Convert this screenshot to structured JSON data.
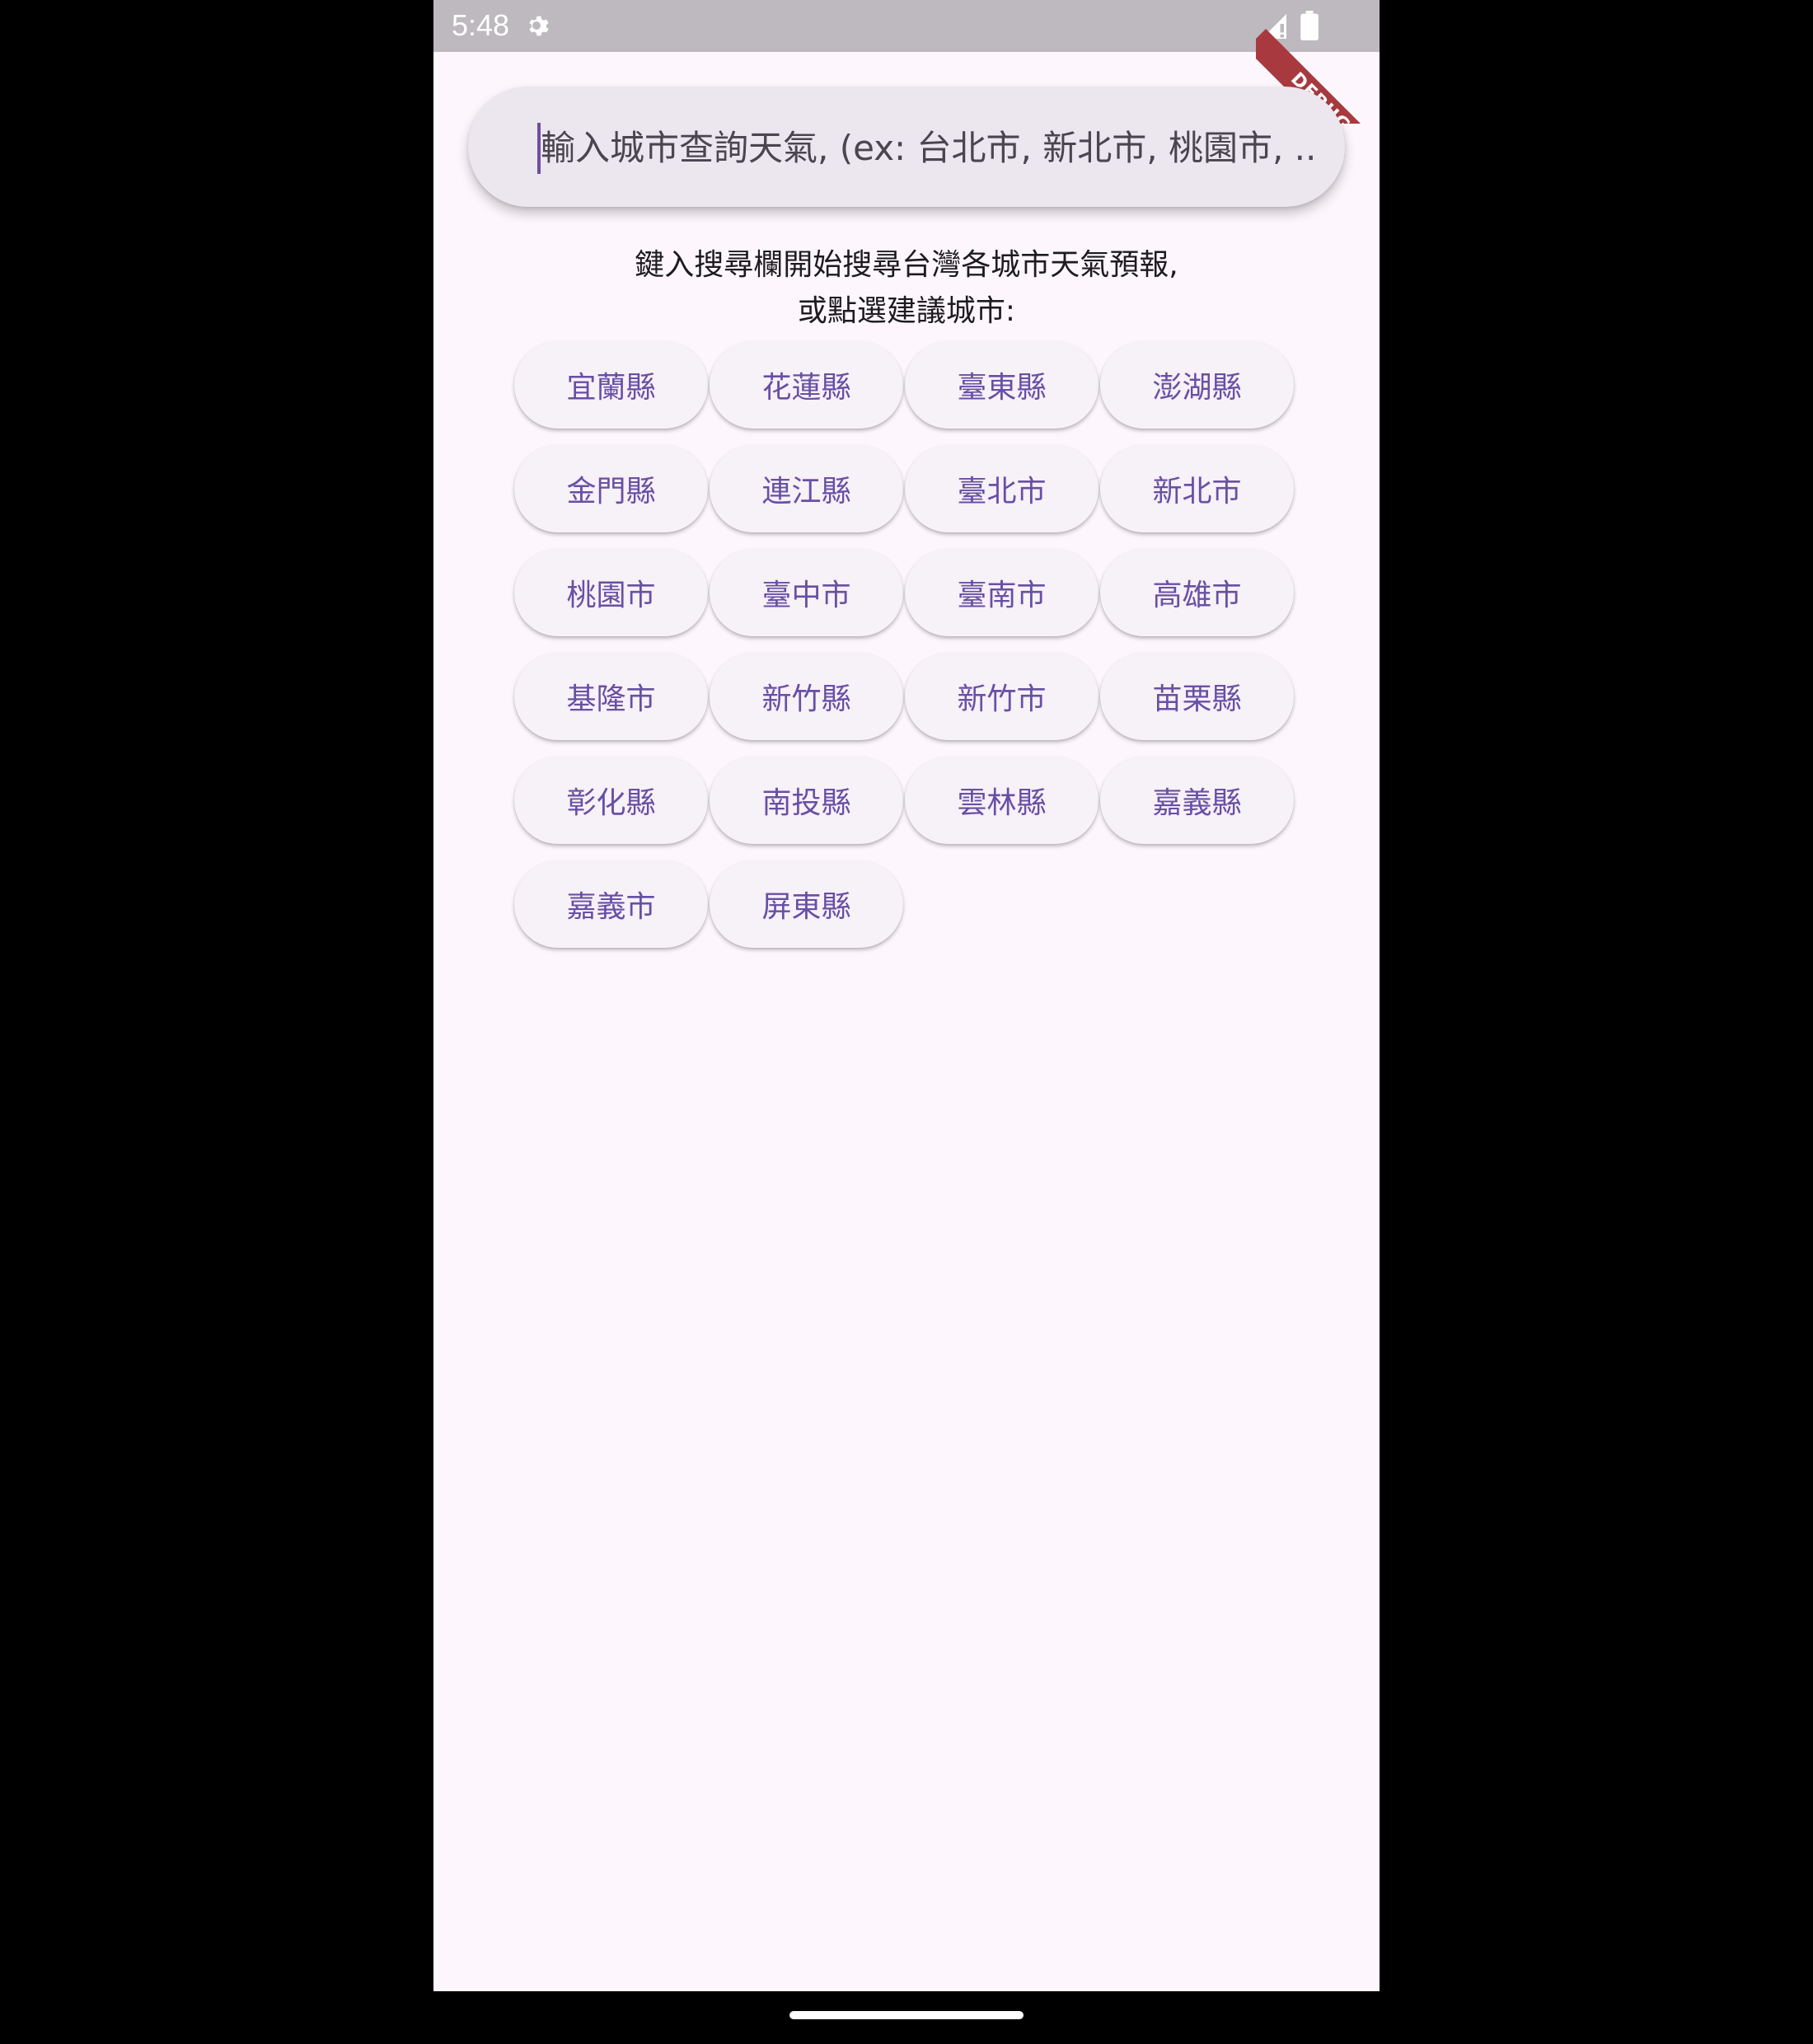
{
  "status_bar": {
    "time": "5:48",
    "icons": [
      "settings-gear-icon",
      "signal-icon",
      "battery-icon"
    ]
  },
  "debug_ribbon": {
    "label": "DEBUG",
    "color": "#a83a3f"
  },
  "search": {
    "placeholder": "輸入城市查詢天氣, (ex: 台北市, 新北市, 桃園市, ...",
    "value": ""
  },
  "instructions": {
    "line1": "鍵入搜尋欄開始搜尋台灣各城市天氣預報,",
    "line2": "或點選建議城市:"
  },
  "cities": [
    "宜蘭縣",
    "花蓮縣",
    "臺東縣",
    "澎湖縣",
    "金門縣",
    "連江縣",
    "臺北市",
    "新北市",
    "桃園市",
    "臺中市",
    "臺南市",
    "高雄市",
    "基隆市",
    "新竹縣",
    "新竹市",
    "苗栗縣",
    "彰化縣",
    "南投縣",
    "雲林縣",
    "嘉義縣",
    "嘉義市",
    "屏東縣"
  ],
  "colors": {
    "accent": "#6750a4",
    "background": "#fdf7fd",
    "status_bar": "#bdb9be",
    "chip_background": "#f7f1f8",
    "search_background": "#ece6ee"
  }
}
